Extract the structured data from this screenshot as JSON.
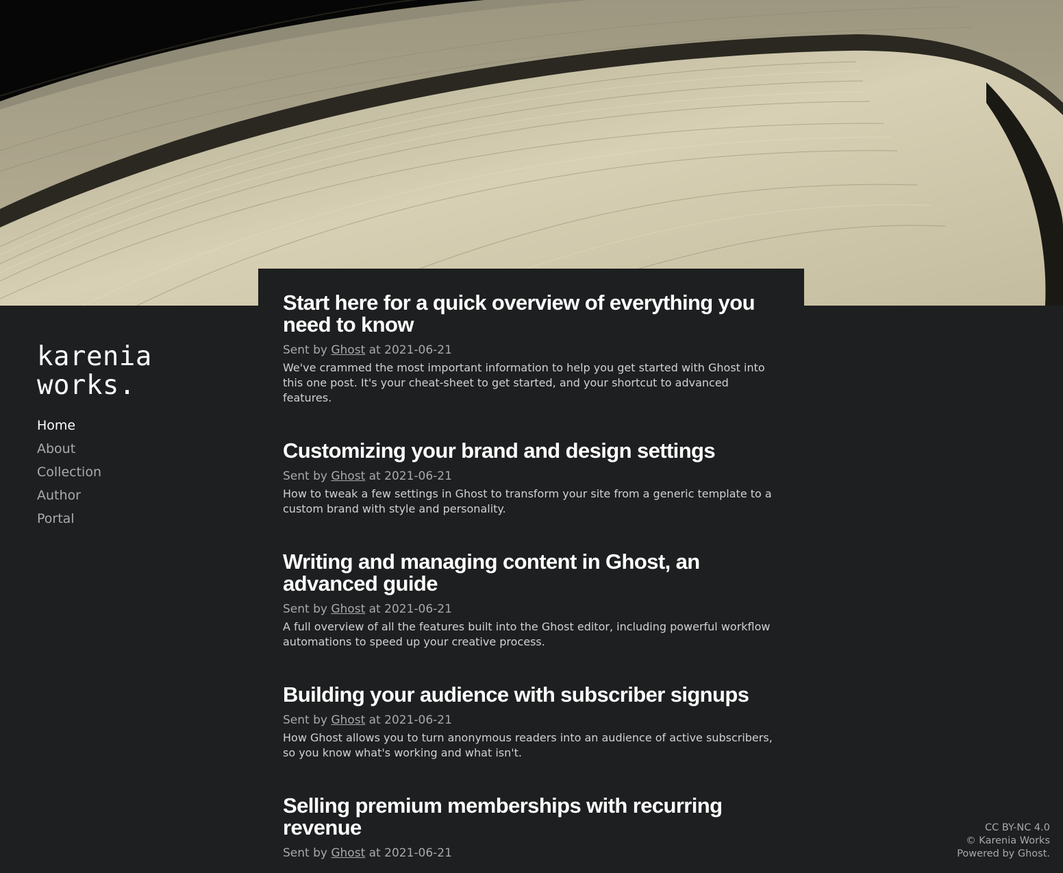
{
  "hero": {
    "image": "saturn-rings-image"
  },
  "site": {
    "title": "karenia\nworks."
  },
  "nav": {
    "items": [
      {
        "label": "Home",
        "current": true
      },
      {
        "label": "About"
      },
      {
        "label": "Collection"
      },
      {
        "label": "Author"
      },
      {
        "label": "Portal"
      }
    ]
  },
  "posts": [
    {
      "title": "Start here for a quick overview of everything you need to know",
      "meta_prefix": "Sent by",
      "author": "Ghost",
      "meta_mid": "at",
      "date": "2021-06-21",
      "excerpt": "We've crammed the most important information to help you get started with Ghost into this one post. It's your cheat-sheet to get started, and your shortcut to advanced features."
    },
    {
      "title": "Customizing your brand and design settings",
      "meta_prefix": "Sent by",
      "author": "Ghost",
      "meta_mid": "at",
      "date": "2021-06-21",
      "excerpt": "How to tweak a few settings in Ghost to transform your site from a generic template to a custom brand with style and personality."
    },
    {
      "title": "Writing and managing content in Ghost, an advanced guide",
      "meta_prefix": "Sent by",
      "author": "Ghost",
      "meta_mid": "at",
      "date": "2021-06-21",
      "excerpt": "A full overview of all the features built into the Ghost editor, including powerful workflow automations to speed up your creative process."
    },
    {
      "title": "Building your audience with subscriber signups",
      "meta_prefix": "Sent by",
      "author": "Ghost",
      "meta_mid": "at",
      "date": "2021-06-21",
      "excerpt": "How Ghost allows you to turn anonymous readers into an audience of active subscribers, so you know what's working and what isn't."
    },
    {
      "title": "Selling premium memberships with recurring revenue",
      "meta_prefix": "Sent by",
      "author": "Ghost",
      "meta_mid": "at",
      "date": "2021-06-21",
      "excerpt": ""
    }
  ],
  "footer": {
    "license": "CC BY-NC 4.0",
    "copyright": "© Karenia Works",
    "powered": "Powered by Ghost."
  }
}
